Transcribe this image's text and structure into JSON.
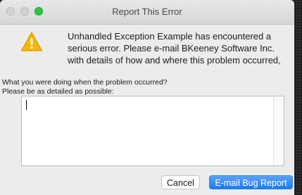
{
  "window": {
    "title": "Report This Error"
  },
  "dialog": {
    "message": "Unhandled Exception Example has encountered a serious error.  Please e-mail BKeeney Software Inc. with details of how and where this problem occurred, so that it can be",
    "prompt_line1": "What you were doing when the problem occurred?",
    "prompt_line2": "Please be as detailed as possible:",
    "details_value": "",
    "icon": "warning-icon"
  },
  "buttons": {
    "cancel_label": "Cancel",
    "email_label": "E-mail Bug Report"
  },
  "colors": {
    "accent": "#1b7bf3",
    "warning": "#f5b800",
    "zoom": "#2ac840"
  }
}
